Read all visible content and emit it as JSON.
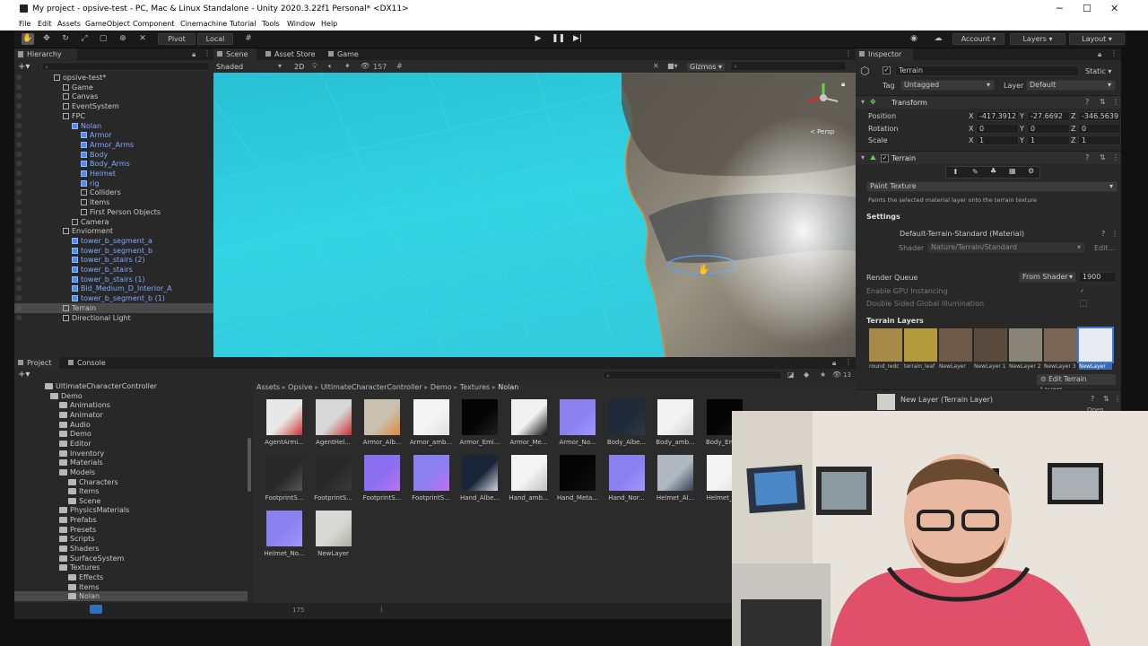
{
  "window": {
    "title": "My project - opsive-test - PC, Mac & Linux Standalone - Unity 2020.3.22f1 Personal* <DX11>",
    "controls": [
      "─",
      "☐",
      "✕"
    ]
  },
  "menu": [
    "File",
    "Edit",
    "Assets",
    "GameObject",
    "Component",
    "Cinemachine",
    "Tutorial",
    "Tools",
    "Window",
    "Help"
  ],
  "toolbar": {
    "pivot": "Pivot",
    "local": "Local",
    "account": "Account",
    "layers": "Layers",
    "layout": "Layout"
  },
  "hierarchy": {
    "tab": "Hierarchy",
    "items": [
      {
        "label": "opsive-test*",
        "depth": 0,
        "type": "scene"
      },
      {
        "label": "Game",
        "depth": 1,
        "type": "obj"
      },
      {
        "label": "Canvas",
        "depth": 1,
        "type": "obj"
      },
      {
        "label": "EventSystem",
        "depth": 1,
        "type": "obj"
      },
      {
        "label": "FPC",
        "depth": 1,
        "type": "obj"
      },
      {
        "label": "Nolan",
        "depth": 2,
        "type": "prefab"
      },
      {
        "label": "Armor",
        "depth": 3,
        "type": "prefab"
      },
      {
        "label": "Armor_Arms",
        "depth": 3,
        "type": "prefab"
      },
      {
        "label": "Body",
        "depth": 3,
        "type": "prefab"
      },
      {
        "label": "Body_Arms",
        "depth": 3,
        "type": "prefab"
      },
      {
        "label": "Helmet",
        "depth": 3,
        "type": "prefab"
      },
      {
        "label": "rig",
        "depth": 3,
        "type": "prefab"
      },
      {
        "label": "Colliders",
        "depth": 3,
        "type": "obj"
      },
      {
        "label": "Items",
        "depth": 3,
        "type": "obj"
      },
      {
        "label": "First Person Objects",
        "depth": 3,
        "type": "obj"
      },
      {
        "label": "Camera",
        "depth": 2,
        "type": "obj"
      },
      {
        "label": "Enviorment",
        "depth": 1,
        "type": "obj"
      },
      {
        "label": "tower_b_segment_a",
        "depth": 2,
        "type": "prefab"
      },
      {
        "label": "tower_b_segment_b",
        "depth": 2,
        "type": "prefab"
      },
      {
        "label": "tower_b_stairs (2)",
        "depth": 2,
        "type": "prefab"
      },
      {
        "label": "tower_b_stairs",
        "depth": 2,
        "type": "prefab"
      },
      {
        "label": "tower_b_stairs (1)",
        "depth": 2,
        "type": "prefab"
      },
      {
        "label": "Bld_Medium_D_Interior_A",
        "depth": 2,
        "type": "prefab"
      },
      {
        "label": "tower_b_segment_b (1)",
        "depth": 2,
        "type": "prefab"
      },
      {
        "label": "Terrain",
        "depth": 1,
        "type": "obj",
        "selected": true
      },
      {
        "label": "Directional Light",
        "depth": 1,
        "type": "obj"
      }
    ]
  },
  "scene": {
    "tabs": [
      "Scene",
      "Asset Store",
      "Game"
    ],
    "shading": "Shaded",
    "mode_2d": "2D",
    "layer_count": "157",
    "gizmos": "Gizmos",
    "persp": "< Persp"
  },
  "inspector": {
    "tab": "Inspector",
    "object_name": "Terrain",
    "static": "Static",
    "tag_label": "Tag",
    "tag": "Untagged",
    "layer_label": "Layer",
    "layer": "Default",
    "transform": {
      "title": "Transform",
      "position_label": "Position",
      "rotation_label": "Rotation",
      "scale_label": "Scale",
      "position": [
        "-417.3912",
        "-27.6692",
        "-346.5639"
      ],
      "rotation": [
        "0",
        "0",
        "0"
      ],
      "scale": [
        "1",
        "1",
        "1"
      ]
    },
    "terrain": {
      "title": "Terrain",
      "mode": "Paint Texture",
      "mode_desc": "Paints the selected material layer onto the terrain texture",
      "settings": "Settings",
      "material": "Default-Terrain-Standard (Material)",
      "shader_label": "Shader",
      "shader": "Nature/Terrain/Standard",
      "edit": "Edit...",
      "render_queue_label": "Render Queue",
      "render_queue_mode": "From Shader",
      "render_queue": "1900",
      "gpu_instancing": "Enable GPU Instancing",
      "double_sided": "Double Sided Global Illumination",
      "layers_title": "Terrain Layers",
      "layers": [
        {
          "label": "round_redc",
          "color": "#a88a48"
        },
        {
          "label": "terrain_leaf",
          "color": "#b39a3d"
        },
        {
          "label": "NewLayer",
          "color": "#6e5a48"
        },
        {
          "label": "NewLayer 1",
          "color": "#5a4a3e"
        },
        {
          "label": "NewLayer 2",
          "color": "#8a8378"
        },
        {
          "label": "NewLayer 3",
          "color": "#7a6555"
        },
        {
          "label": "NewLayer",
          "color": "#e8ecf0",
          "selected": true
        }
      ],
      "edit_layers": "Edit Terrain Layers...",
      "new_layer": "New Layer (Terrain Layer)",
      "open": "Open"
    }
  },
  "project": {
    "tabs": [
      "Project",
      "Console"
    ],
    "count": "13",
    "breadcrumb": [
      "Assets",
      "Opsive",
      "UltimateCharacterController",
      "Demo",
      "Textures",
      "Nolan"
    ],
    "tree": [
      {
        "label": "UltimateCharacterController",
        "depth": 0
      },
      {
        "label": "Demo",
        "depth": 1
      },
      {
        "label": "Animations",
        "depth": 2
      },
      {
        "label": "Animator",
        "depth": 2
      },
      {
        "label": "Audio",
        "depth": 2
      },
      {
        "label": "Demo",
        "depth": 2
      },
      {
        "label": "Editor",
        "depth": 2
      },
      {
        "label": "Inventory",
        "depth": 2
      },
      {
        "label": "Materials",
        "depth": 2
      },
      {
        "label": "Models",
        "depth": 2
      },
      {
        "label": "Characters",
        "depth": 3
      },
      {
        "label": "Items",
        "depth": 3
      },
      {
        "label": "Scene",
        "depth": 3
      },
      {
        "label": "PhysicsMaterials",
        "depth": 2
      },
      {
        "label": "Prefabs",
        "depth": 2
      },
      {
        "label": "Presets",
        "depth": 2
      },
      {
        "label": "Scripts",
        "depth": 2
      },
      {
        "label": "Shaders",
        "depth": 2
      },
      {
        "label": "SurfaceSystem",
        "depth": 2
      },
      {
        "label": "Textures",
        "depth": 2
      },
      {
        "label": "Effects",
        "depth": 3
      },
      {
        "label": "Items",
        "depth": 3
      },
      {
        "label": "Nolan",
        "depth": 3,
        "selected": true
      }
    ],
    "assets": [
      {
        "label": "AgentArmi...",
        "color": "#e8e8e8",
        "accent": "#c83030"
      },
      {
        "label": "AgentHel...",
        "color": "#d8d8d8",
        "accent": "#c83030"
      },
      {
        "label": "Armor_Alb...",
        "color": "#c8c0b0",
        "accent": "#e08a3a"
      },
      {
        "label": "Armor_amb...",
        "color": "#f4f4f4",
        "accent": "#e0e0e0"
      },
      {
        "label": "Armor_Emi...",
        "color": "#050505",
        "accent": "#202020"
      },
      {
        "label": "Armor_Me...",
        "color": "#f0f0f0",
        "accent": "#101010"
      },
      {
        "label": "Armor_No...",
        "color": "#8a80f0",
        "accent": "#a098ff"
      },
      {
        "label": "Body_Albe...",
        "color": "#1e2a38",
        "accent": "#303844"
      },
      {
        "label": "Body_amb...",
        "color": "#f2f2f2",
        "accent": "#d0d0d0"
      },
      {
        "label": "Body_Emi...",
        "color": "#050505",
        "accent": "#151515"
      },
      {
        "label": "FootprintS...",
        "color": "#282828",
        "accent": "#555555"
      },
      {
        "label": "FootprintS...",
        "color": "#282828",
        "accent": "#3a3a3a"
      },
      {
        "label": "FootprintS...",
        "color": "#8a70f0",
        "accent": "#c070f0"
      },
      {
        "label": "FootprintS...",
        "color": "#8a80f0",
        "accent": "#c070f0"
      },
      {
        "label": "Hand_Albe...",
        "color": "#1a2538",
        "accent": "#d0d8e0"
      },
      {
        "label": "Hand_amb...",
        "color": "#f4f4f4",
        "accent": "#c0c0c0"
      },
      {
        "label": "Hand_Meta...",
        "color": "#050505",
        "accent": "#101010"
      },
      {
        "label": "Hand_Nor...",
        "color": "#8a80f0",
        "accent": "#a098ff"
      },
      {
        "label": "Helmet_Al...",
        "color": "#b0b8c0",
        "accent": "#304050"
      },
      {
        "label": "Helmet_a...",
        "color": "#f4f4f4",
        "accent": "#e0e0e0"
      },
      {
        "label": "Helmet_No...",
        "color": "#8a80f0",
        "accent": "#a098ff"
      },
      {
        "label": "NewLayer",
        "color": "#d8d8d4",
        "accent": "#b0b0aa"
      }
    ],
    "status": "175"
  }
}
